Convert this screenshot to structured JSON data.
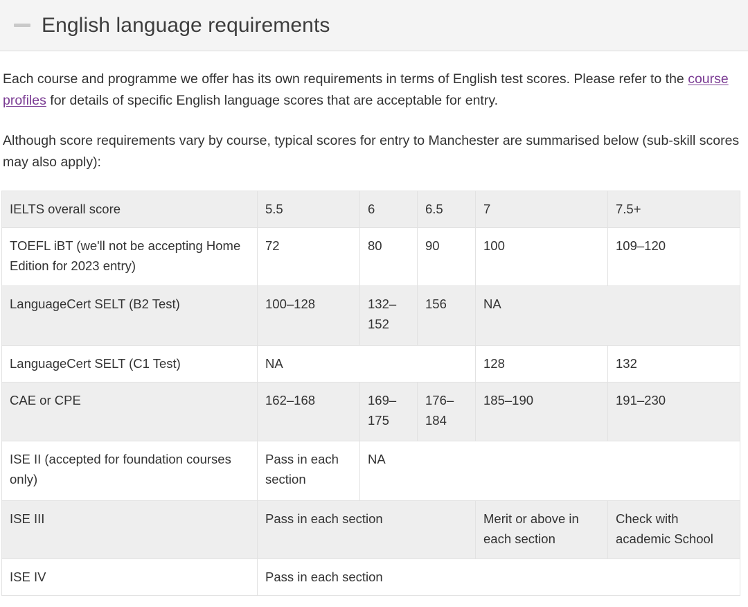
{
  "accordion": {
    "title": "English language requirements",
    "toggle_icon": "minus-icon",
    "state": "expanded"
  },
  "intro": {
    "paragraph_1_before_link": "Each course and programme we offer has its own requirements in terms of English test scores. Please refer to the ",
    "paragraph_1_link": "course profiles",
    "paragraph_1_after_link": " for details of specific English language scores that are acceptable for entry.",
    "paragraph_2": "Although score requirements vary by course, typical scores for entry to Manchester are summarised below (sub-skill scores may also apply):"
  },
  "colors": {
    "link": "#7a3b93",
    "header_band": "#f4f4f4",
    "row_shaded": "#eeeeee",
    "border": "#e2e2e2",
    "text": "#333333"
  },
  "table": {
    "header": {
      "label": "IELTS overall score",
      "scores": [
        "5.5",
        "6",
        "6.5",
        "7",
        "7.5+"
      ]
    },
    "rows": [
      {
        "label": "TOEFL iBT (we'll not be accepting Home Edition for 2023 entry)",
        "shaded": false,
        "cells": [
          {
            "text": "72",
            "span": 1
          },
          {
            "text": "80",
            "span": 1
          },
          {
            "text": "90",
            "span": 1
          },
          {
            "text": "100",
            "span": 1
          },
          {
            "text": "109–120",
            "span": 1
          }
        ]
      },
      {
        "label": "LanguageCert SELT (B2 Test)",
        "shaded": true,
        "cells": [
          {
            "text": "100–128",
            "span": 1
          },
          {
            "text": "132–152",
            "span": 1
          },
          {
            "text": "156",
            "span": 1
          },
          {
            "text": "NA",
            "span": 2
          }
        ]
      },
      {
        "label": "LanguageCert SELT (C1 Test)",
        "shaded": false,
        "cells": [
          {
            "text": "NA",
            "span": 3
          },
          {
            "text": "128",
            "span": 1
          },
          {
            "text": "132",
            "span": 1
          }
        ]
      },
      {
        "label": "CAE or CPE",
        "shaded": true,
        "cells": [
          {
            "text": "162–168",
            "span": 1
          },
          {
            "text": "169–175",
            "span": 1
          },
          {
            "text": "176–184",
            "span": 1
          },
          {
            "text": "185–190",
            "span": 1
          },
          {
            "text": "191–230",
            "span": 1
          }
        ]
      },
      {
        "label": "ISE II (accepted for foundation courses only)",
        "shaded": false,
        "cells": [
          {
            "text": "Pass in each section",
            "span": 1
          },
          {
            "text": "NA",
            "span": 4
          }
        ]
      },
      {
        "label": "ISE III",
        "shaded": true,
        "cells": [
          {
            "text": "Pass in each section",
            "span": 3
          },
          {
            "text": "Merit or above in each section",
            "span": 1
          },
          {
            "text": "Check with academic School",
            "span": 1
          }
        ]
      },
      {
        "label": "ISE IV",
        "shaded": false,
        "cells": [
          {
            "text": "Pass in each section",
            "span": 5
          }
        ]
      }
    ]
  }
}
